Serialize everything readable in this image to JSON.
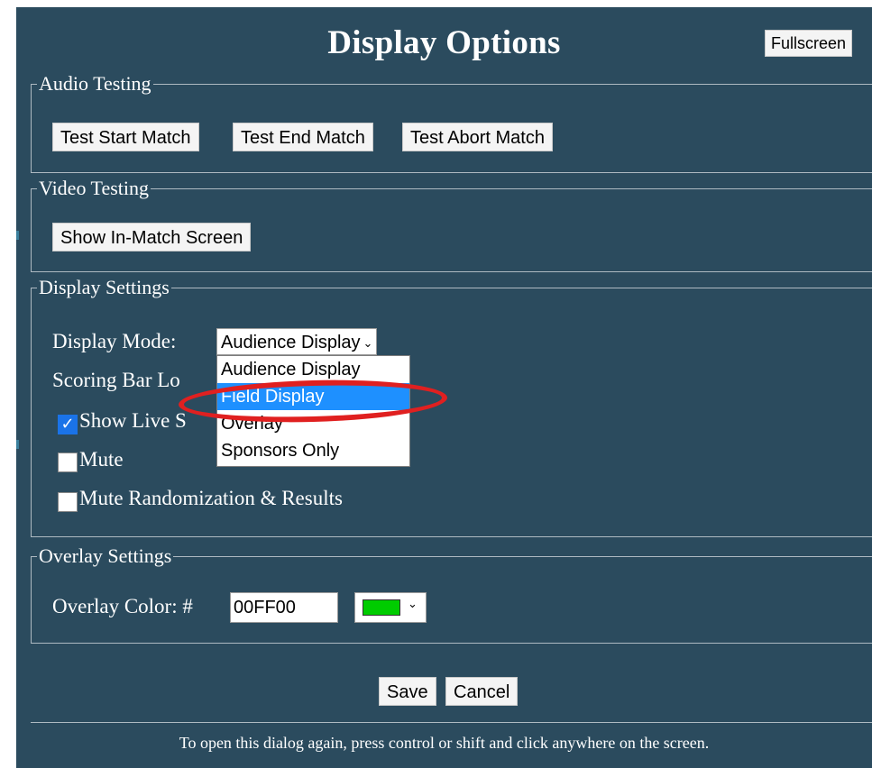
{
  "dialog": {
    "title": "Display Options",
    "fullscreen_label": "Fullscreen"
  },
  "audio_testing": {
    "legend": "Audio Testing",
    "buttons": [
      "Test Start Match",
      "Test End Match",
      "Test Abort Match"
    ]
  },
  "video_testing": {
    "legend": "Video Testing",
    "show_in_match_label": "Show In-Match Screen"
  },
  "display_settings": {
    "legend": "Display Settings",
    "display_mode_label": "Display Mode:",
    "display_mode_selected": "Audience Display",
    "display_mode_options": [
      "Audience Display",
      "Field Display",
      "Overlay",
      "Sponsors Only"
    ],
    "highlighted_option": "Field Display",
    "scoring_bar_label": "Scoring Bar Lo",
    "show_live_label": "Show Live S",
    "show_live_checked": true,
    "mute_label": "Mute",
    "mute_checked": false,
    "mute_random_label": "Mute Randomization & Results",
    "mute_random_checked": false
  },
  "overlay_settings": {
    "legend": "Overlay Settings",
    "color_label": "Overlay Color: #",
    "color_value": "00FF00",
    "swatch_color": "#00cc00"
  },
  "actions": {
    "save_label": "Save",
    "cancel_label": "Cancel"
  },
  "footer": {
    "hint": "To open this dialog again, press control or shift and click anywhere on the screen."
  },
  "colors": {
    "panel_bg": "#2b4b5e",
    "highlight": "#1e90ff",
    "annotation_ring": "#e02020"
  }
}
